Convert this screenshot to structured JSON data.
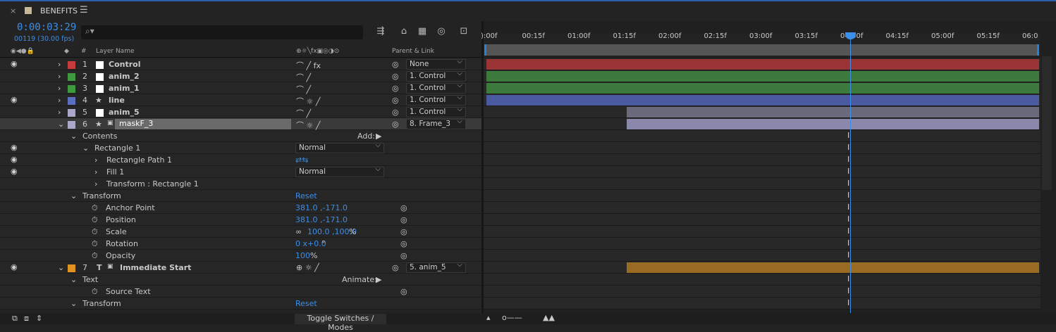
{
  "tab": {
    "close": "×",
    "title": "BENEFITS",
    "menu": "☰"
  },
  "timecode": "0:00:03:29",
  "fps": "00119 (30.00 fps)",
  "search_icon": "⌕▾",
  "columns": {
    "label_icon": "◆",
    "num": "#",
    "layer_name": "Layer Name",
    "switches": "⊕☼╲fx▣◎◑⊙",
    "parent": "Parent & Link"
  },
  "layers": [
    {
      "num": "1",
      "name": "Control",
      "color": "#c33b3b",
      "parent": "None",
      "eye": "👁",
      "bold": true
    },
    {
      "num": "2",
      "name": "anim_2",
      "color": "#3f9a3f",
      "parent": "1. Control",
      "bold": true
    },
    {
      "num": "3",
      "name": "anim_1",
      "color": "#3f9a3f",
      "parent": "1. Control",
      "bold": true
    },
    {
      "num": "4",
      "name": "line",
      "color": "#5a6fbf",
      "parent": "1. Control",
      "eye": "👁",
      "bold": true
    },
    {
      "num": "5",
      "name": "anim_5",
      "color": "#a9a8c9",
      "parent": "1. Control",
      "bold": true
    },
    {
      "num": "6",
      "name": "maskF_3",
      "color": "#a9a8c9",
      "parent": "8. Frame_3",
      "bold": true
    }
  ],
  "props": {
    "contents": "Contents",
    "add": "Add:",
    "rect1": "Rectangle 1",
    "normal1": "Normal",
    "rect_path": "Rectangle Path 1",
    "fill1": "Fill 1",
    "normal2": "Normal",
    "transform_rect": "Transform : Rectangle 1",
    "transform": "Transform",
    "reset": "Reset",
    "anchor": "Anchor Point",
    "anchor_v": "381.0 ,-171.0",
    "position": "Position",
    "position_v": "381.0 ,-171.0",
    "scale": "Scale",
    "scale_v": "100.0 ,100.0",
    "scale_u": "%",
    "rotation": "Rotation",
    "rotation_v": "0 x+0.0",
    "rotation_u": "°",
    "opacity": "Opacity",
    "opacity_v": "100",
    "opacity_u": "%"
  },
  "layer7": {
    "num": "7",
    "name": "Immediate Start",
    "color": "#e0941f",
    "parent": "5. anim_5",
    "eye": "👁"
  },
  "text_props": {
    "text": "Text",
    "animate": "Animate:",
    "source": "Source Text",
    "transform": "Transform",
    "reset": "Reset"
  },
  "bottom": {
    "toggle": "Toggle Switches / Modes"
  },
  "ruler": [
    "):00f",
    "00:15f",
    "01:00f",
    "01:15f",
    "02:00f",
    "02:15f",
    "03:00f",
    "03:15f",
    "04:00f",
    "04:15f",
    "05:00f",
    "05:15f",
    "06:0"
  ],
  "bars": [
    {
      "start": 0.0,
      "end": 1.0,
      "color": "#9b3535"
    },
    {
      "start": 0.0,
      "end": 1.0,
      "color": "#3d7a3d"
    },
    {
      "start": 0.0,
      "end": 1.0,
      "color": "#3d7a3d"
    },
    {
      "start": 0.0,
      "end": 1.0,
      "color": "#4a5aa0"
    },
    {
      "start": 0.254,
      "end": 1.0,
      "color": "#6b6a7d"
    },
    {
      "start": 0.254,
      "end": 1.0,
      "color": "#8a89ad"
    }
  ],
  "orange_bar": {
    "start": 0.254,
    "end": 1.0,
    "color": "#9a6b22"
  },
  "playhead_time": "04:00f"
}
